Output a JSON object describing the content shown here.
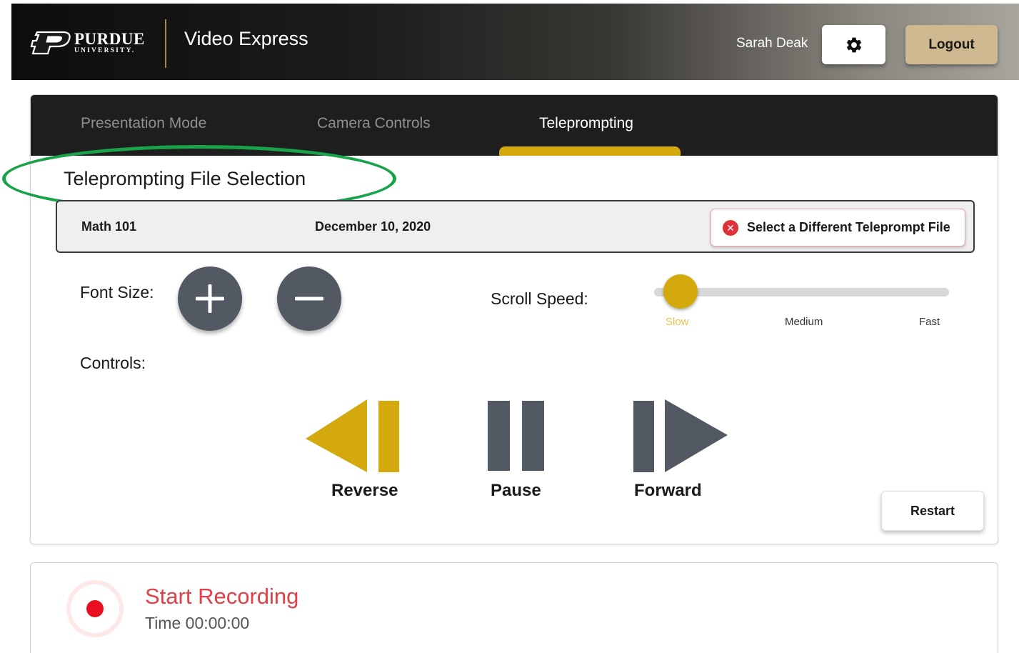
{
  "header": {
    "logo_word": "PURDUE",
    "logo_sub": "UNIVERSITY.",
    "app_title": "Video Express",
    "user_name": "Sarah Deak",
    "settings_icon": "gear-icon",
    "logout_label": "Logout",
    "brand_gold": "#cfb991"
  },
  "tabs": [
    {
      "label": "Presentation Mode",
      "active": false
    },
    {
      "label": "Camera Controls",
      "active": false
    },
    {
      "label": "Teleprompting",
      "active": true
    }
  ],
  "teleprompt": {
    "file_heading": "Teleprompting File Selection",
    "file_name": "Math 101",
    "file_date": "December 10, 2020",
    "select_file_label": "Select a Different Teleprompt File",
    "font_size_label": "Font Size:",
    "scroll_speed_label": "Scroll Speed:",
    "speed_options": [
      "Slow",
      "Medium",
      "Fast"
    ],
    "speed_selected": "Slow",
    "controls_label": "Controls:",
    "reverse_label": "Reverse",
    "pause_label": "Pause",
    "forward_label": "Forward",
    "restart_label": "Restart",
    "accent": "#d4a90e",
    "control_gray": "#525962"
  },
  "recording": {
    "title": "Start Recording",
    "time": "Time 00:00:00",
    "record_color": "#e8101e"
  },
  "annotation_color": "#19a24a"
}
